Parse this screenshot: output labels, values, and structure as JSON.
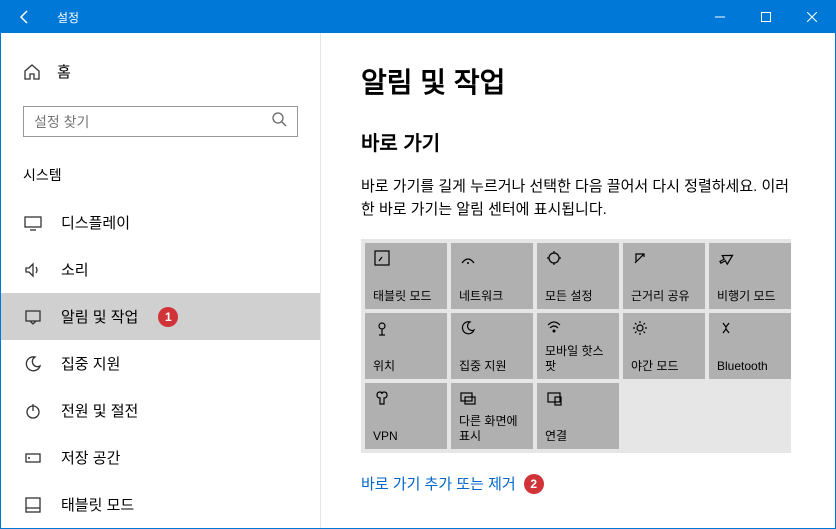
{
  "titlebar": {
    "title": "설정"
  },
  "sidebar": {
    "home_label": "홈",
    "search_placeholder": "설정 찾기",
    "section_label": "시스템",
    "items": [
      {
        "label": "디스플레이"
      },
      {
        "label": "소리"
      },
      {
        "label": "알림 및 작업"
      },
      {
        "label": "집중 지원"
      },
      {
        "label": "전원 및 절전"
      },
      {
        "label": "저장 공간"
      },
      {
        "label": "태블릿 모드"
      }
    ],
    "badge_1": "1"
  },
  "content": {
    "page_title": "알림 및 작업",
    "section_title": "바로 가기",
    "description": "바로 가기를 길게 누르거나 선택한 다음 끌어서 다시 정렬하세요. 이러한 바로 가기는 알림 센터에 표시됩니다.",
    "tiles": [
      {
        "label": "태블릿 모드"
      },
      {
        "label": "네트워크"
      },
      {
        "label": "모든 설정"
      },
      {
        "label": "근거리 공유"
      },
      {
        "label": "비행기 모드"
      },
      {
        "label": "위치"
      },
      {
        "label": "집중 지원"
      },
      {
        "label": "모바일 핫스팟"
      },
      {
        "label": "야간 모드"
      },
      {
        "label": "Bluetooth"
      },
      {
        "label": "VPN"
      },
      {
        "label": "다른 화면에 표시"
      },
      {
        "label": "연결"
      }
    ],
    "link_text": "바로 가기 추가 또는 제거",
    "badge_2": "2"
  }
}
